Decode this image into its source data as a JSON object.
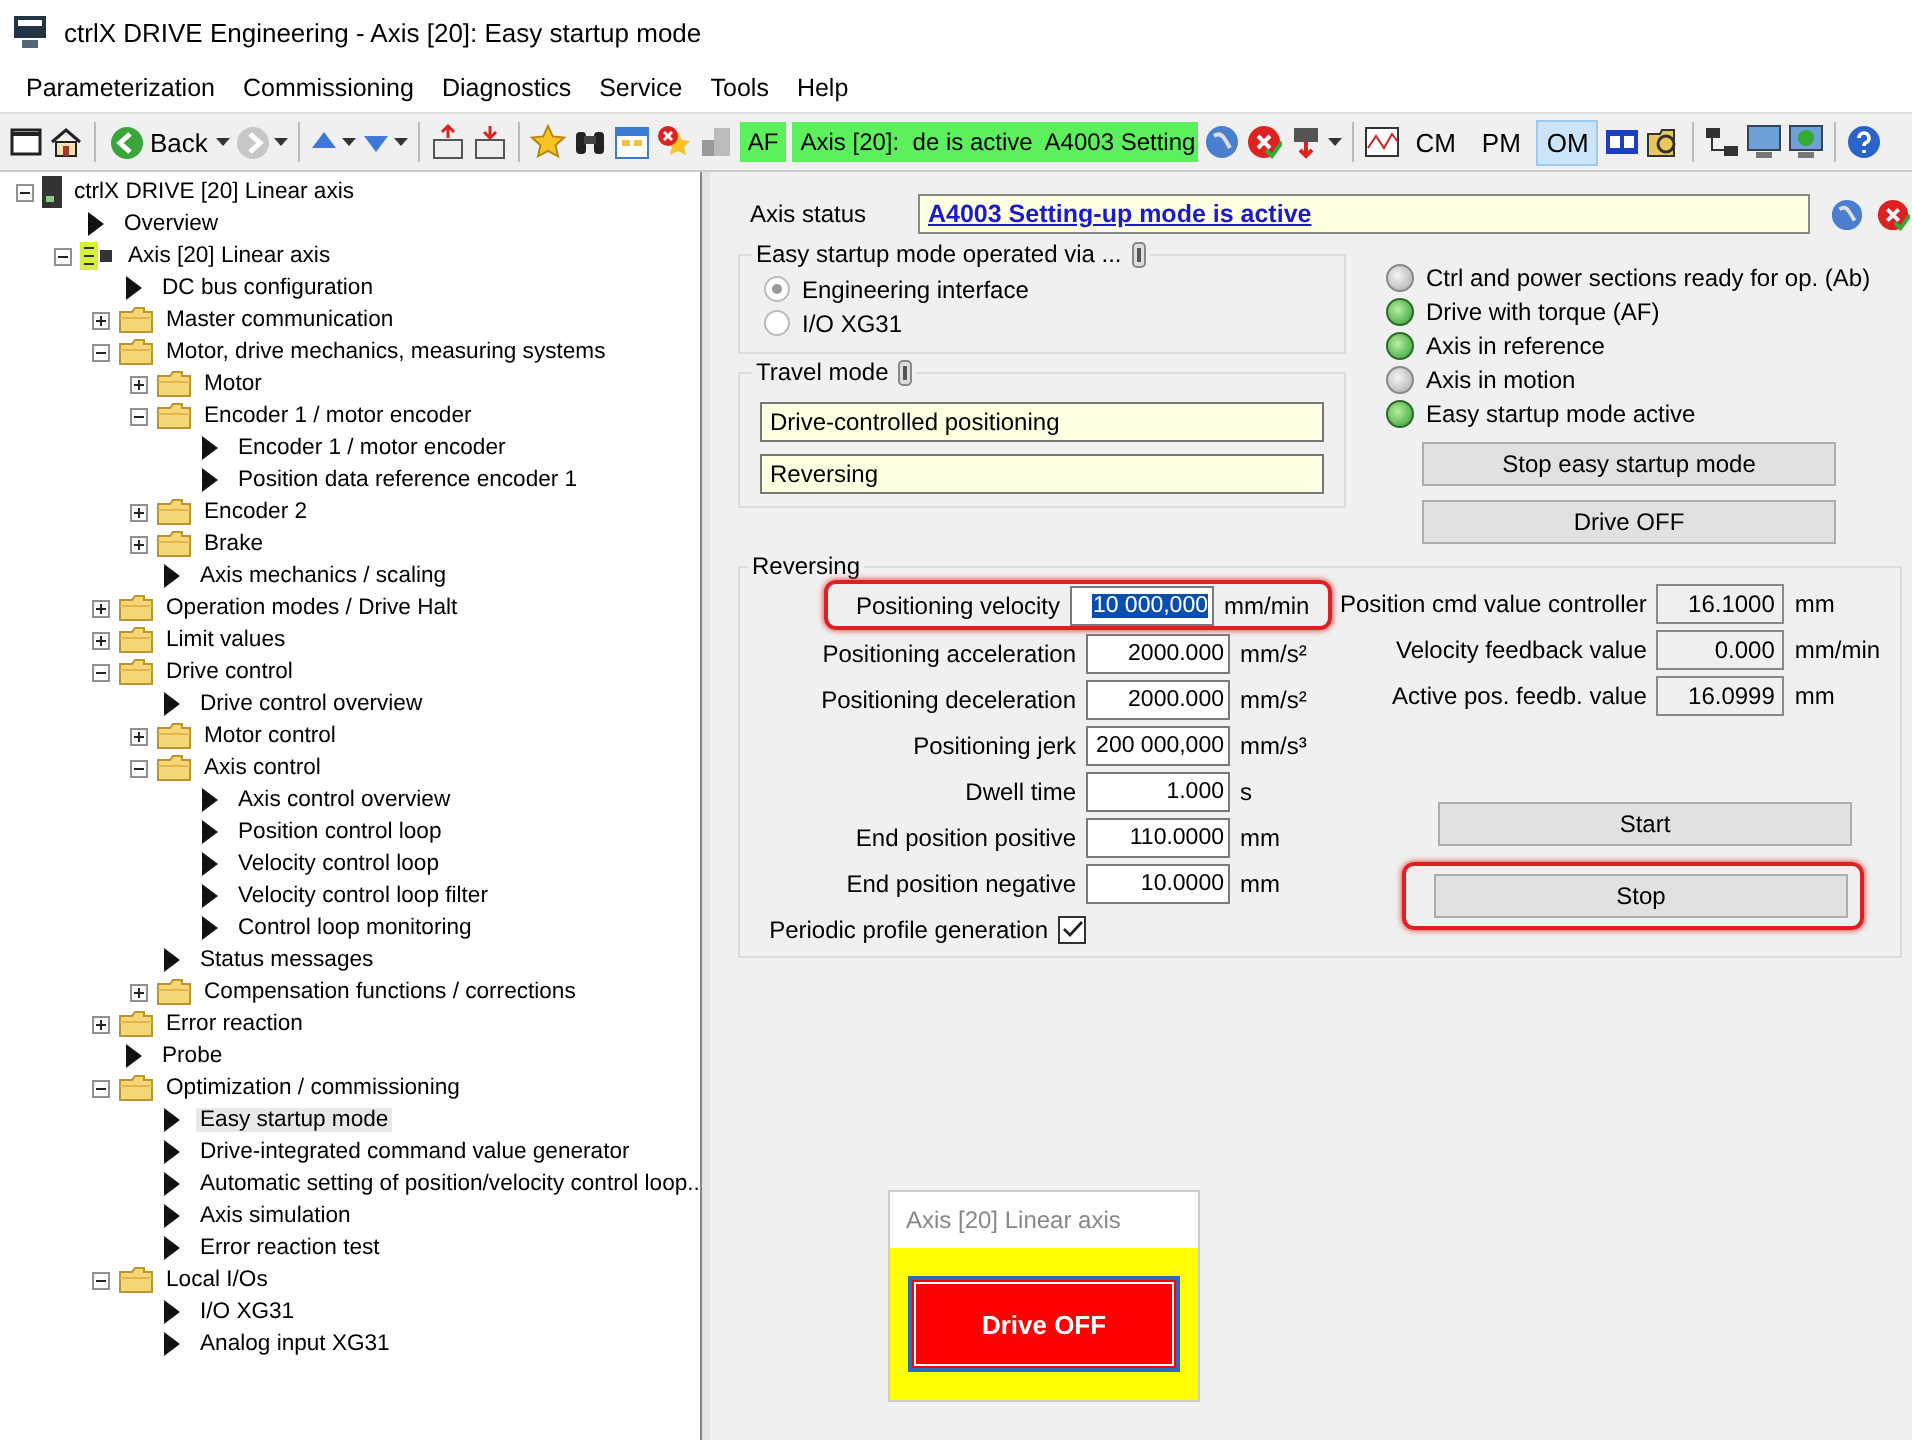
{
  "window": {
    "title": "ctrlX DRIVE Engineering - Axis [20]: Easy startup mode"
  },
  "menu": [
    "Parameterization",
    "Commissioning",
    "Diagnostics",
    "Service",
    "Tools",
    "Help"
  ],
  "toolbar": {
    "back": "Back",
    "status": [
      "AF",
      "Axis [20]:  de is active  A4003 Setting"
    ],
    "modes": [
      {
        "label": "CM",
        "selected": false
      },
      {
        "label": "PM",
        "selected": false
      },
      {
        "label": "OM",
        "selected": true
      }
    ]
  },
  "tree": [
    {
      "label": "ctrlX DRIVE [20] Linear axis",
      "kind": "device",
      "expanded": true,
      "selected": false,
      "children": [
        {
          "label": "Overview",
          "kind": "page",
          "selected": false
        },
        {
          "label": "Axis [20] Linear axis",
          "kind": "axis",
          "expanded": true,
          "selected": false,
          "children": [
            {
              "label": "DC bus configuration",
              "kind": "page",
              "selected": false
            },
            {
              "label": "Master communication",
              "kind": "folder",
              "expanded": false,
              "selected": false
            },
            {
              "label": "Motor, drive mechanics, measuring systems",
              "kind": "folder",
              "expanded": true,
              "selected": false,
              "children": [
                {
                  "label": "Motor",
                  "kind": "folder",
                  "expanded": false,
                  "selected": false
                },
                {
                  "label": "Encoder 1 / motor encoder",
                  "kind": "folder",
                  "expanded": true,
                  "selected": false,
                  "children": [
                    {
                      "label": "Encoder 1 / motor encoder",
                      "kind": "page",
                      "selected": false
                    },
                    {
                      "label": "Position data reference encoder 1",
                      "kind": "page",
                      "selected": false
                    }
                  ]
                },
                {
                  "label": "Encoder 2",
                  "kind": "folder",
                  "expanded": false,
                  "selected": false
                },
                {
                  "label": "Brake",
                  "kind": "folder",
                  "expanded": false,
                  "selected": false
                },
                {
                  "label": "Axis mechanics / scaling",
                  "kind": "page",
                  "selected": false
                }
              ]
            },
            {
              "label": "Operation modes / Drive Halt",
              "kind": "folder",
              "expanded": false,
              "selected": false
            },
            {
              "label": "Limit values",
              "kind": "folder",
              "expanded": false,
              "selected": false
            },
            {
              "label": "Drive control",
              "kind": "folder",
              "expanded": true,
              "selected": false,
              "children": [
                {
                  "label": "Drive control overview",
                  "kind": "page",
                  "selected": false
                },
                {
                  "label": "Motor control",
                  "kind": "folder",
                  "expanded": false,
                  "selected": false
                },
                {
                  "label": "Axis control",
                  "kind": "folder",
                  "expanded": true,
                  "selected": false,
                  "children": [
                    {
                      "label": "Axis control overview",
                      "kind": "page",
                      "selected": false
                    },
                    {
                      "label": "Position control loop",
                      "kind": "page",
                      "selected": false
                    },
                    {
                      "label": "Velocity control loop",
                      "kind": "page",
                      "selected": false
                    },
                    {
                      "label": "Velocity control loop filter",
                      "kind": "page",
                      "selected": false
                    },
                    {
                      "label": "Control loop monitoring",
                      "kind": "page",
                      "selected": false
                    }
                  ]
                },
                {
                  "label": "Status messages",
                  "kind": "page",
                  "selected": false
                },
                {
                  "label": "Compensation functions / corrections",
                  "kind": "folder",
                  "expanded": false,
                  "selected": false
                }
              ]
            },
            {
              "label": "Error reaction",
              "kind": "folder",
              "expanded": false,
              "selected": false
            },
            {
              "label": "Probe",
              "kind": "page",
              "selected": false
            },
            {
              "label": "Optimization / commissioning",
              "kind": "folder",
              "expanded": true,
              "selected": false,
              "children": [
                {
                  "label": "Easy startup mode",
                  "kind": "page",
                  "selected": true
                },
                {
                  "label": "Drive-integrated command value generator",
                  "kind": "page",
                  "selected": false
                },
                {
                  "label": "Automatic setting of position/velocity control loop...",
                  "kind": "page",
                  "selected": false
                },
                {
                  "label": "Axis simulation",
                  "kind": "page",
                  "selected": false
                },
                {
                  "label": "Error reaction test",
                  "kind": "page",
                  "selected": false
                }
              ]
            },
            {
              "label": "Local I/Os",
              "kind": "folder",
              "expanded": true,
              "selected": false,
              "children": [
                {
                  "label": "I/O XG31",
                  "kind": "page",
                  "selected": false
                },
                {
                  "label": "Analog input XG31",
                  "kind": "page",
                  "selected": false
                }
              ]
            }
          ]
        }
      ]
    }
  ],
  "axis_status": {
    "label": "Axis status",
    "value": "A4003 Setting-up mode is active"
  },
  "operated_via": {
    "title": "Easy startup mode operated via ...",
    "options": [
      {
        "label": "Engineering interface",
        "selected": true
      },
      {
        "label": "I/O XG31",
        "selected": false
      }
    ]
  },
  "travel_mode": {
    "title": "Travel mode",
    "values": [
      "Drive-controlled positioning",
      "Reversing"
    ]
  },
  "indicators": [
    {
      "label": "Ctrl and power sections ready for op. (Ab)",
      "on": false
    },
    {
      "label": "Drive with torque (AF)",
      "on": true
    },
    {
      "label": "Axis in reference",
      "on": true
    },
    {
      "label": "Axis in motion",
      "on": false
    },
    {
      "label": "Easy startup mode active",
      "on": true
    }
  ],
  "mode_buttons": [
    "Stop easy startup mode",
    "Drive OFF"
  ],
  "reversing": {
    "title": "Reversing",
    "params": [
      {
        "label": "Positioning velocity",
        "value": "10 000,000",
        "unit": "mm/min",
        "selected": true,
        "highlighted": true
      },
      {
        "label": "Positioning acceleration",
        "value": "2000.000",
        "unit": "mm/s²",
        "selected": false,
        "highlighted": false
      },
      {
        "label": "Positioning deceleration",
        "value": "2000.000",
        "unit": "mm/s²",
        "selected": false,
        "highlighted": false
      },
      {
        "label": "Positioning jerk",
        "value": "200 000,000",
        "unit": "mm/s³",
        "selected": false,
        "highlighted": false
      },
      {
        "label": "Dwell time",
        "value": "1.000",
        "unit": "s",
        "selected": false,
        "highlighted": false
      },
      {
        "label": "End position positive",
        "value": "110.0000",
        "unit": "mm",
        "selected": false,
        "highlighted": false
      },
      {
        "label": "End position negative",
        "value": "10.0000",
        "unit": "mm",
        "selected": false,
        "highlighted": false
      }
    ],
    "periodic": {
      "label": "Periodic profile generation",
      "checked": true
    },
    "actual": [
      {
        "label": "Position cmd value controller",
        "value": "16.1000",
        "unit": "mm"
      },
      {
        "label": "Velocity feedback value",
        "value": "0.000",
        "unit": "mm/min"
      },
      {
        "label": "Active pos. feedb. value",
        "value": "16.0999",
        "unit": "mm"
      }
    ],
    "buttons": [
      {
        "label": "Start",
        "highlighted": false
      },
      {
        "label": "Stop",
        "highlighted": true
      }
    ]
  },
  "popup": {
    "title": "Axis [20] Linear axis",
    "button": "Drive OFF"
  }
}
